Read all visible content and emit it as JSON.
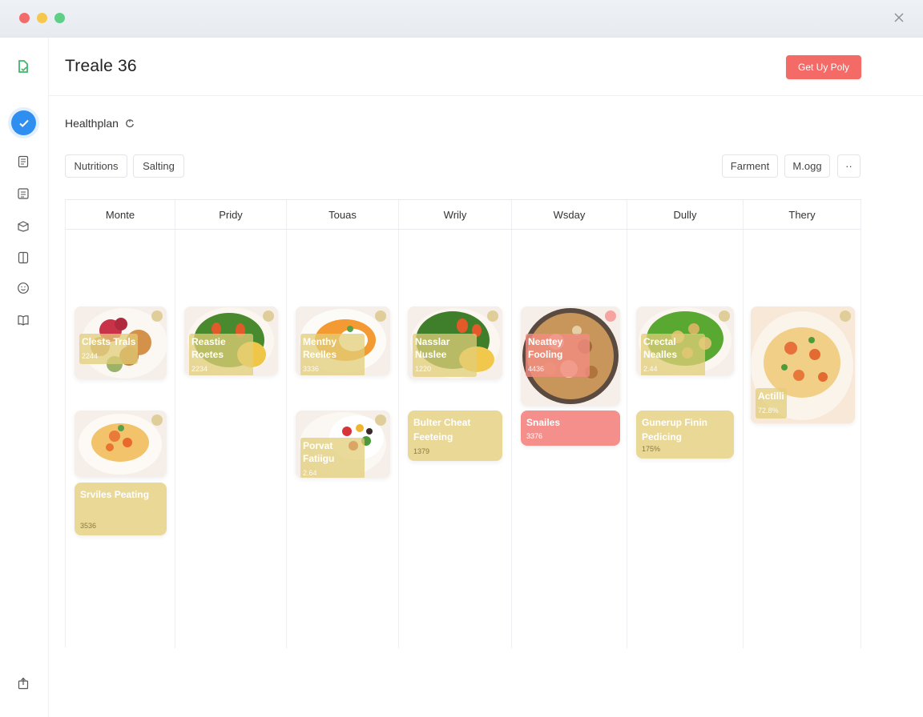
{
  "window": {
    "close_icon": "close-icon"
  },
  "header": {
    "title": "Treale 36",
    "cta_label": "Get Uy Poly",
    "logo_icon": "document-icon"
  },
  "sidebar": {
    "items": [
      {
        "icon": "check-circle-icon"
      },
      {
        "icon": "document-list-icon"
      },
      {
        "icon": "list-icon"
      },
      {
        "icon": "box-icon"
      },
      {
        "icon": "book-icon"
      },
      {
        "icon": "smiley-icon"
      },
      {
        "icon": "open-book-icon"
      },
      {
        "icon": "share-icon"
      }
    ]
  },
  "section": {
    "title": "Healthplan",
    "info_icon": "refresh-icon"
  },
  "filters": {
    "left": [
      "Nutritions",
      "Salting"
    ],
    "right": [
      "Farment",
      "M.ogg",
      "··"
    ]
  },
  "columns": [
    {
      "label": "Monte",
      "cards": [
        {
          "kind": "photo",
          "title": "Clests Trals",
          "value": "2244"
        },
        {
          "kind": "photo",
          "title": "",
          "value": ""
        },
        {
          "kind": "note",
          "title": "Srviles Peating",
          "value": "3536"
        }
      ]
    },
    {
      "label": "Pridy",
      "cards": [
        {
          "kind": "photo",
          "title": "Reastie Roetes",
          "value": "2234"
        }
      ]
    },
    {
      "label": "Touas",
      "cards": [
        {
          "kind": "photo",
          "title": "Menthy Reelles",
          "value": "3336"
        },
        {
          "kind": "photo",
          "title": "Porvat Fatiigu",
          "value": "2.64"
        }
      ]
    },
    {
      "label": "Wrily",
      "cards": [
        {
          "kind": "photo",
          "title": "Nasslar Nuslee",
          "value": "1220"
        },
        {
          "kind": "note",
          "title": "Bulter Cheat Feeteing",
          "value": "1379"
        }
      ]
    },
    {
      "label": "Wsday",
      "cards": [
        {
          "kind": "photo",
          "title": "Neattey Fooling",
          "value": "4436"
        },
        {
          "kind": "note",
          "title": "Snailes",
          "value": "3376"
        }
      ]
    },
    {
      "label": "Dully",
      "cards": [
        {
          "kind": "photo",
          "title": "Crectal Nealles",
          "value": "2.44"
        },
        {
          "kind": "note",
          "title": "Gunerup Finin Pedicing",
          "value": "175%"
        }
      ]
    },
    {
      "label": "Thery",
      "cards": [
        {
          "kind": "photo",
          "title": "Actilli",
          "value": "72.8%"
        }
      ]
    }
  ],
  "colors": {
    "accent": "#f46a66",
    "active": "#2e8ff0",
    "note": "#e9d896",
    "note_pink": "#f58f8b"
  }
}
